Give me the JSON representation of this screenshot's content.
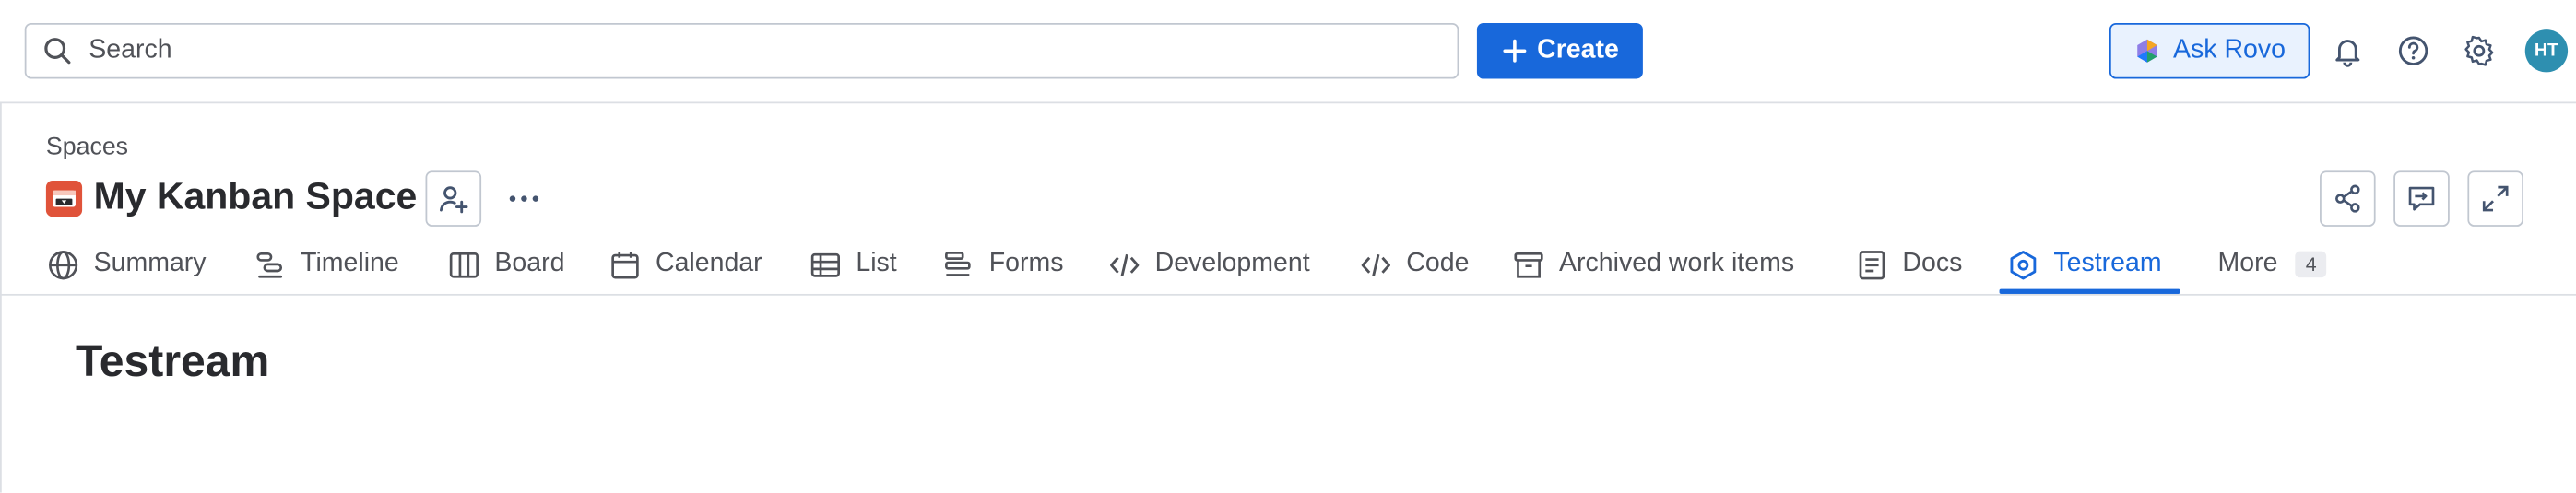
{
  "topbar": {
    "search_placeholder": "Search",
    "create_label": "Create",
    "ask_rovo_label": "Ask Rovo",
    "avatar_initials": "HT",
    "icons": [
      "search-icon",
      "plus-icon",
      "rovo-icon",
      "bell-icon",
      "help-icon",
      "gear-icon"
    ]
  },
  "header": {
    "breadcrumb": "Spaces",
    "space_title": "My Kanban Space"
  },
  "tabs": [
    {
      "label": "Summary",
      "icon": "globe-icon"
    },
    {
      "label": "Timeline",
      "icon": "timeline-icon"
    },
    {
      "label": "Board",
      "icon": "board-icon"
    },
    {
      "label": "Calendar",
      "icon": "calendar-icon"
    },
    {
      "label": "List",
      "icon": "list-icon"
    },
    {
      "label": "Forms",
      "icon": "forms-icon"
    },
    {
      "label": "Development",
      "icon": "code-icon"
    },
    {
      "label": "Code",
      "icon": "code-icon"
    },
    {
      "label": "Archived work items",
      "icon": "archive-icon"
    },
    {
      "label": "Docs",
      "icon": "docs-icon"
    },
    {
      "label": "Testream",
      "icon": "hexagon-icon",
      "active": true
    },
    {
      "label": "More",
      "count": "4"
    }
  ],
  "main": {
    "heading": "Testream"
  },
  "colors": {
    "brand_blue": "#1868db",
    "space_icon_bg": "#e0533a",
    "avatar_bg": "#2e8fb0"
  }
}
